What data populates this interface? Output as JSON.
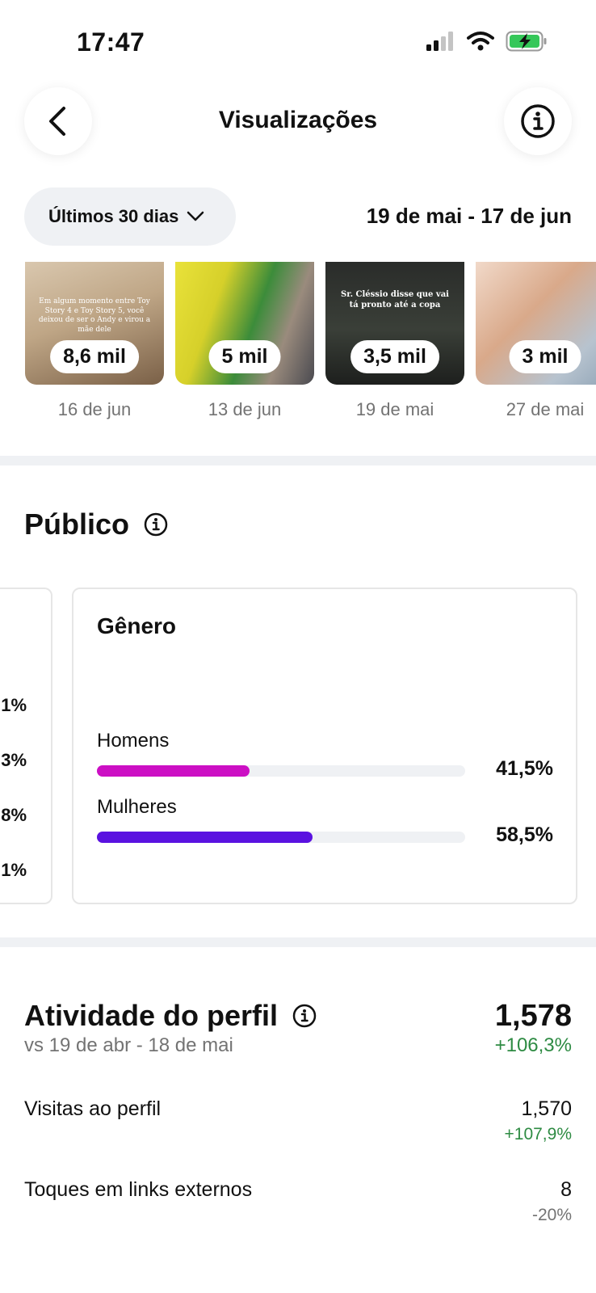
{
  "status_bar": {
    "time": "17:47",
    "icons": [
      "cellular-signal-icon",
      "wifi-icon",
      "battery-charging-icon"
    ]
  },
  "nav": {
    "title": "Visualizações",
    "back_icon": "chevron-left-icon",
    "info_icon": "info-icon"
  },
  "filter": {
    "period_label": "Últimos 30 dias",
    "date_range": "19 de mai - 17 de jun"
  },
  "top_content": [
    {
      "views": "8,6 mil",
      "date": "16 de jun",
      "caption": "Em algum momento entre Toy Story 4 e Toy Story 5, você deixou de ser o Andy e virou a mãe dele"
    },
    {
      "views": "5 mil",
      "date": "13 de jun"
    },
    {
      "views": "3,5 mil",
      "date": "19 de mai",
      "caption": "Sr. Cléssio disse que vai tá pronto até a copa"
    },
    {
      "views": "3 mil",
      "date": "27 de mai"
    }
  ],
  "audience": {
    "title": "Público",
    "left_card_values": [
      "1%",
      "3%",
      "8%",
      "1%"
    ],
    "gender": {
      "title": "Gênero",
      "items": [
        {
          "label": "Homens",
          "value": "41,5%",
          "fraction": 0.415,
          "color": "#cc0fc4"
        },
        {
          "label": "Mulheres",
          "value": "58,5%",
          "fraction": 0.585,
          "color": "#5a12e0"
        }
      ]
    }
  },
  "activity": {
    "title": "Atividade do perfil",
    "comparison": "vs 19 de abr - 18 de mai",
    "total": "1,578",
    "total_change": "+106,3%",
    "metrics": [
      {
        "label": "Visitas ao perfil",
        "value": "1,570",
        "change": "+107,9%",
        "change_color": "#2e8b43"
      },
      {
        "label": "Toques em links externos",
        "value": "8",
        "change": "-20%",
        "change_color": "#737373"
      }
    ]
  },
  "colors": {
    "positive": "#2e8b43",
    "muted": "#737373",
    "divider": "#eff1f4"
  }
}
